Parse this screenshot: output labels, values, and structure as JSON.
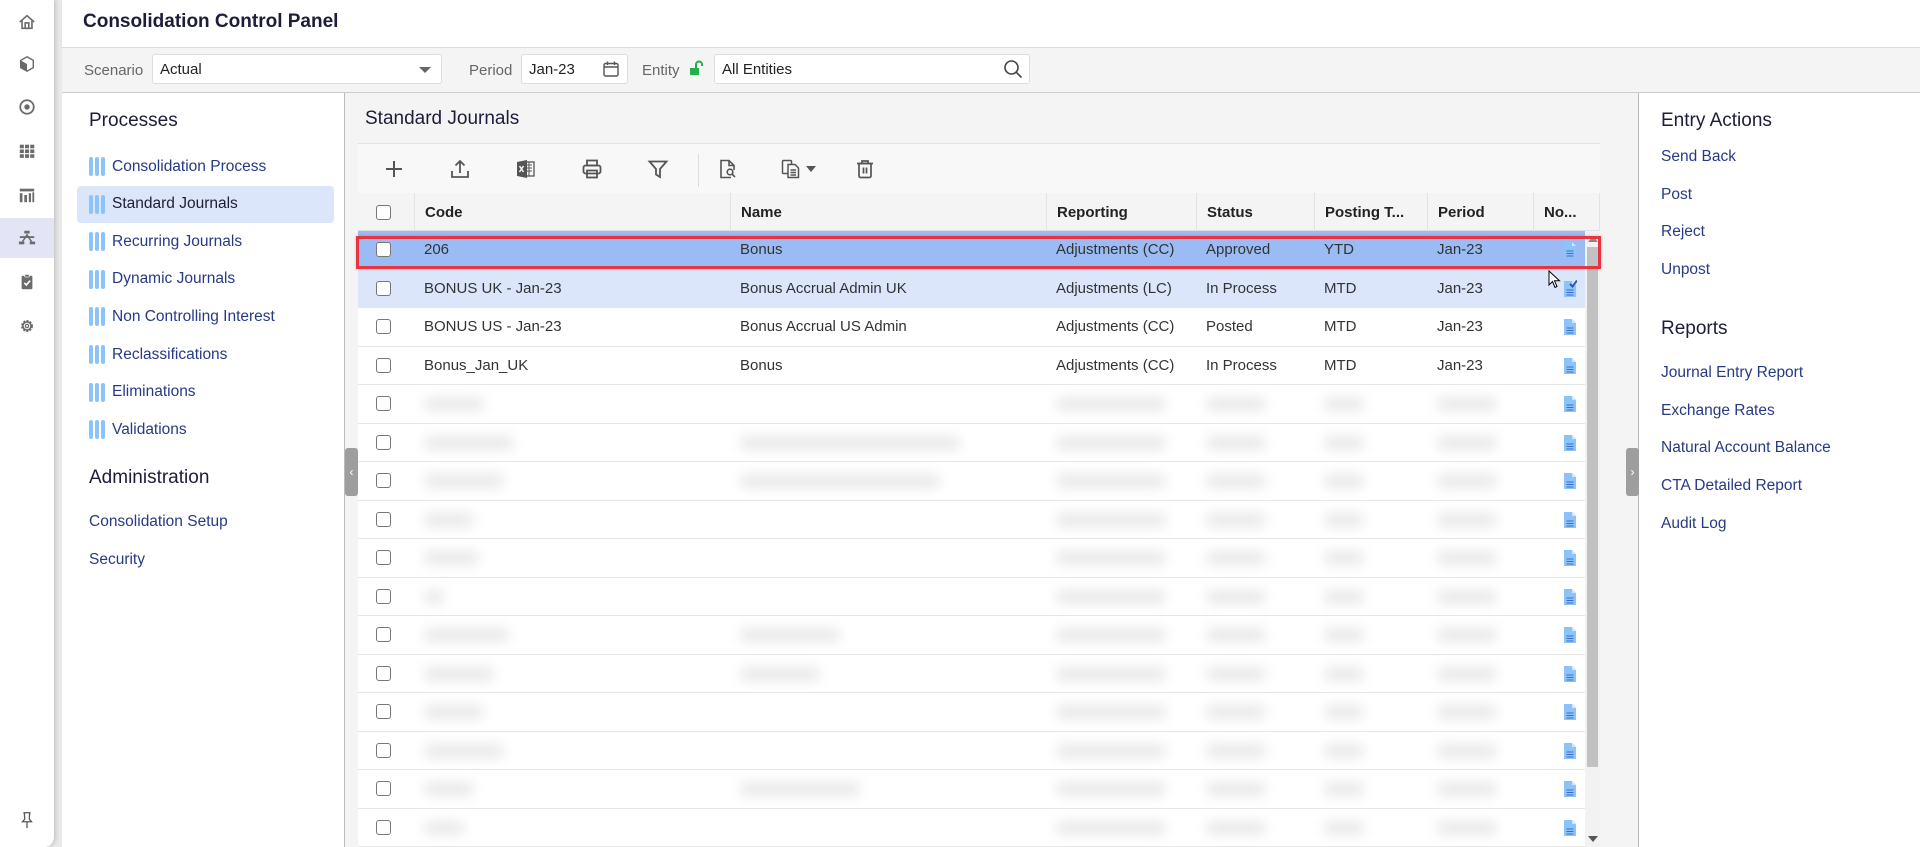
{
  "app": {
    "title": "Consolidation Control Panel"
  },
  "rail": {
    "icons": [
      "home-icon",
      "cube-icon",
      "target-icon",
      "grid-icon",
      "report-icon",
      "hierarchy-icon",
      "clipboard-check-icon",
      "gear-icon"
    ],
    "active": "hierarchy-icon",
    "pin_icon": "pin-icon"
  },
  "filters": {
    "scenario_label": "Scenario",
    "scenario_value": "Actual",
    "period_label": "Period",
    "period_value": "Jan-23",
    "entity_label": "Entity",
    "entity_value": "All Entities"
  },
  "left": {
    "processes_title": "Processes",
    "processes": [
      {
        "label": "Consolidation Process",
        "active": false
      },
      {
        "label": "Standard Journals",
        "active": true
      },
      {
        "label": "Recurring Journals",
        "active": false
      },
      {
        "label": "Dynamic Journals",
        "active": false
      },
      {
        "label": "Non Controlling Interest",
        "active": false
      },
      {
        "label": "Reclassifications",
        "active": false
      },
      {
        "label": "Eliminations",
        "active": false
      },
      {
        "label": "Validations",
        "active": false
      }
    ],
    "admin_title": "Administration",
    "admin": [
      {
        "label": "Consolidation Setup"
      },
      {
        "label": "Security"
      }
    ]
  },
  "main": {
    "title": "Standard Journals",
    "toolbar": [
      "add",
      "upload",
      "export-excel",
      "print",
      "filter",
      "preview",
      "copy",
      "delete"
    ],
    "columns": [
      "Code",
      "Name",
      "Reporting",
      "Status",
      "Posting T...",
      "Period",
      "No..."
    ],
    "rows": [
      {
        "code": "206",
        "name": "Bonus",
        "reporting": "Adjustments (CC)",
        "status": "Approved",
        "posting": "YTD",
        "period": "Jan-23",
        "note": "doc",
        "state": "selected"
      },
      {
        "code": "BONUS UK - Jan-23",
        "name": "Bonus Accrual Admin UK",
        "reporting": "Adjustments (LC)",
        "status": "In Process",
        "posting": "MTD",
        "period": "Jan-23",
        "note": "doc-check",
        "state": "hover"
      },
      {
        "code": "BONUS US - Jan-23",
        "name": "Bonus Accrual US Admin",
        "reporting": "Adjustments (CC)",
        "status": "Posted",
        "posting": "MTD",
        "period": "Jan-23",
        "note": "doc",
        "state": ""
      },
      {
        "code": "Bonus_Jan_UK",
        "name": "Bonus",
        "reporting": "Adjustments (CC)",
        "status": "In Process",
        "posting": "MTD",
        "period": "Jan-23",
        "note": "doc",
        "state": ""
      }
    ],
    "blurred_rows": 12
  },
  "right": {
    "entry_title": "Entry Actions",
    "entry_actions": [
      "Send Back",
      "Post",
      "Reject",
      "Unpost"
    ],
    "reports_title": "Reports",
    "reports": [
      "Journal Entry Report",
      "Exchange Rates",
      "Natural Account Balance",
      "CTA Detailed Report",
      "Audit Log"
    ]
  },
  "colors": {
    "accent_link": "#273a84",
    "selected_row": "#9bbbf5",
    "hover_row": "#dbe6fb",
    "highlight_border": "#e8343f",
    "entity_lock": "#21b24b",
    "doc_icon": "#8dc3fb"
  }
}
